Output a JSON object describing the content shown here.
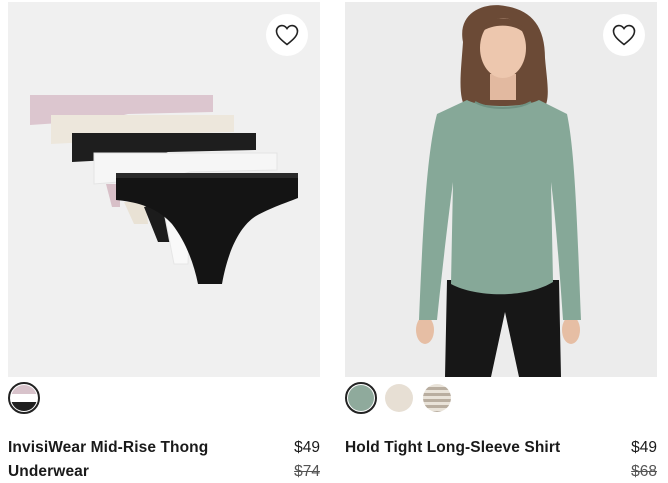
{
  "products": [
    {
      "title": "InvisiWear Mid-Rise Thong Underwear",
      "price": "$49",
      "original_price": "$74",
      "wishlist_icon": "heart-outline-icon",
      "swatches": [
        {
          "name": "multipack",
          "colors": [
            "#d8c3cb",
            "#ffffff",
            "#1f1f1f"
          ],
          "selected": true
        }
      ],
      "garment_colors": [
        "#dcc6cf",
        "#ede7dc",
        "#1c1c1c",
        "#f7f7f7",
        "#151515"
      ]
    },
    {
      "title": "Hold Tight Long-Sleeve Shirt",
      "price": "$49",
      "original_price": "$68",
      "wishlist_icon": "heart-outline-icon",
      "swatches": [
        {
          "name": "sage",
          "colors": [
            "#8faa9c"
          ],
          "selected": true
        },
        {
          "name": "oat",
          "colors": [
            "#e7dfd4"
          ],
          "selected": false
        },
        {
          "name": "stripe",
          "colors": [
            "#e9e3d9",
            "#b9aea0"
          ],
          "selected": false
        }
      ],
      "garment_colors": [
        "#86a898",
        "#1a1a1a",
        "#6b4a36"
      ]
    }
  ]
}
